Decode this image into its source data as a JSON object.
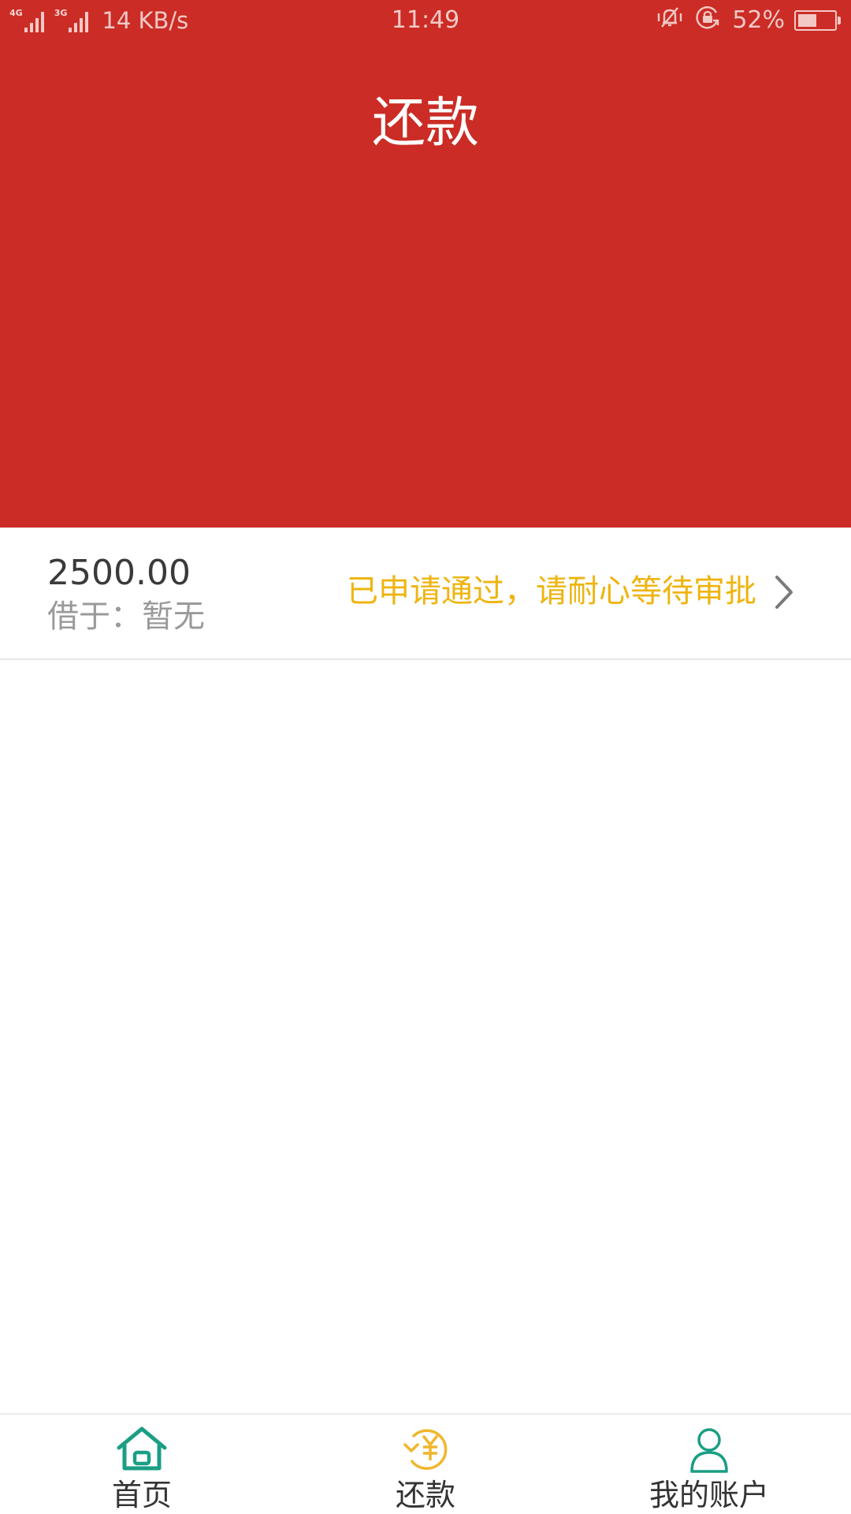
{
  "status_bar": {
    "signal1_tag": "4G",
    "signal2_tag": "3G",
    "net_speed": "14 KB/s",
    "time": "11:49",
    "battery_percent": "52%",
    "battery_level": 0.52
  },
  "header": {
    "title": "还款",
    "background_color": "#cb2c25"
  },
  "loan_record": {
    "amount": "2500.00",
    "lender": "借于：暂无",
    "status": "已申请通过，请耐心等待审批",
    "status_color": "#eeb40f"
  },
  "tabbar": {
    "tabs": [
      {
        "label": "首页",
        "icon": "home-icon",
        "color": "#1a9e84"
      },
      {
        "label": "还款",
        "icon": "repay-yuan-icon",
        "color": "#f0b62c",
        "active": true
      },
      {
        "label": "我的账户",
        "icon": "account-person-icon",
        "color": "#1a9e84"
      }
    ]
  }
}
